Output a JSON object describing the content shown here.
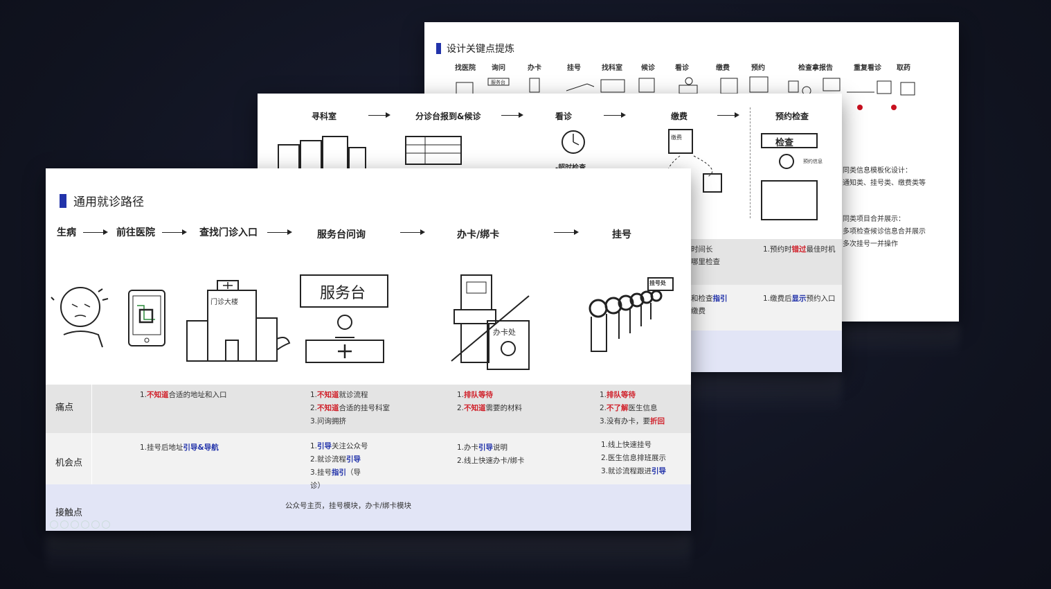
{
  "slide3": {
    "title": "设计关键点提炼",
    "steps": [
      "找医院",
      "询问",
      "办卡",
      "挂号",
      "找科室",
      "候诊",
      "看诊",
      "缴费",
      "预约",
      "检查拿报告",
      "重复看诊",
      "取药"
    ],
    "notes": [
      "同类信息模板化设计：",
      "通知类、挂号类、缴费类等",
      "同类项目合并展示：",
      "多项检查候诊信息合并展示",
      "多次挂号一并操作"
    ],
    "sketch_labels": [
      "服务台"
    ]
  },
  "slide2": {
    "steps": [
      "寻科室",
      "分诊台报到&候诊",
      "看诊",
      "缴费",
      "预约检查"
    ],
    "sketch_labels": [
      "检查",
      "预约信息",
      "缴费",
      "-超时检查"
    ],
    "cell_r1_a": "时间长",
    "cell_r1_b": "哪里检查",
    "cell_r1_c_pre": "1.预约时",
    "cell_r1_c_red": "错过",
    "cell_r1_c_post": "最佳时机",
    "cell_r2_a_pre": "和检查",
    "cell_r2_a_blue": "指引",
    "cell_r2_b": "缴费",
    "cell_r2_c_pre": "1.缴费后",
    "cell_r2_c_blue": "显示",
    "cell_r2_c_post": "预约入口"
  },
  "slide1": {
    "title": "通用就诊路径",
    "steps": [
      "生病",
      "前往医院",
      "查找门诊入口",
      "服务台问询",
      "办卡/绑卡",
      "挂号"
    ],
    "sketch_labels": {
      "building": "门诊大楼",
      "desk": "服务台",
      "card": "办卡处",
      "queue": "挂号处"
    },
    "rows": {
      "pain": "痛点",
      "opportunity": "机会点",
      "touch": "接触点"
    },
    "pain": {
      "c1_pre": "1.",
      "c1_red": "不知道",
      "c1_post": "合适的地址和入口",
      "c2_l1_pre": "1.",
      "c2_l1_red": "不知道",
      "c2_l1_post": "就诊流程",
      "c2_l2_pre": "2.",
      "c2_l2_red": "不知道",
      "c2_l2_post": "合适的挂号科室",
      "c2_l3": "3.问询拥挤",
      "c3_l1_pre": "1.",
      "c3_l1_red": "排队等待",
      "c3_l2_pre": "2.",
      "c3_l2_red": "不知道",
      "c3_l2_post": "需要的材料",
      "c4_l1_pre": "1.",
      "c4_l1_red": "排队等待",
      "c4_l2_pre": "2.",
      "c4_l2_red": "不了解",
      "c4_l2_post": "医生信息",
      "c4_l3_pre": "3.没有办卡，要",
      "c4_l3_red": "折回"
    },
    "opp": {
      "c1_pre": "1.挂号后地址",
      "c1_blue": "引导&导航",
      "c2_l1_pre": "1.",
      "c2_l1_blue": "引导",
      "c2_l1_post": "关注公众号",
      "c2_l2_pre": "2.就诊流程",
      "c2_l2_blue": "引导",
      "c2_l3_pre": "3.挂号",
      "c2_l3_blue": "指引",
      "c2_l3_post": "（导",
      "c2_l4": "诊）",
      "c3_l1_pre": "1.办卡",
      "c3_l1_blue": "引导",
      "c3_l1_post": "说明",
      "c3_l2": "2.线上快速办卡/绑卡",
      "c4_l1": "1.线上快速挂号",
      "c4_l2": "2.医生信息排班展示",
      "c4_l3_pre": "3.就诊流程跟进",
      "c4_l3_blue": "引导"
    },
    "touch": "公众号主页，挂号模块，办卡/绑卡模块"
  },
  "colors": {
    "accent": "#2233aa",
    "red": "#d0202a",
    "gray_row": "#e4e4e4",
    "light_row": "#f2f2f2",
    "blue_row": "#e2e5f6",
    "background": "#10131f"
  }
}
